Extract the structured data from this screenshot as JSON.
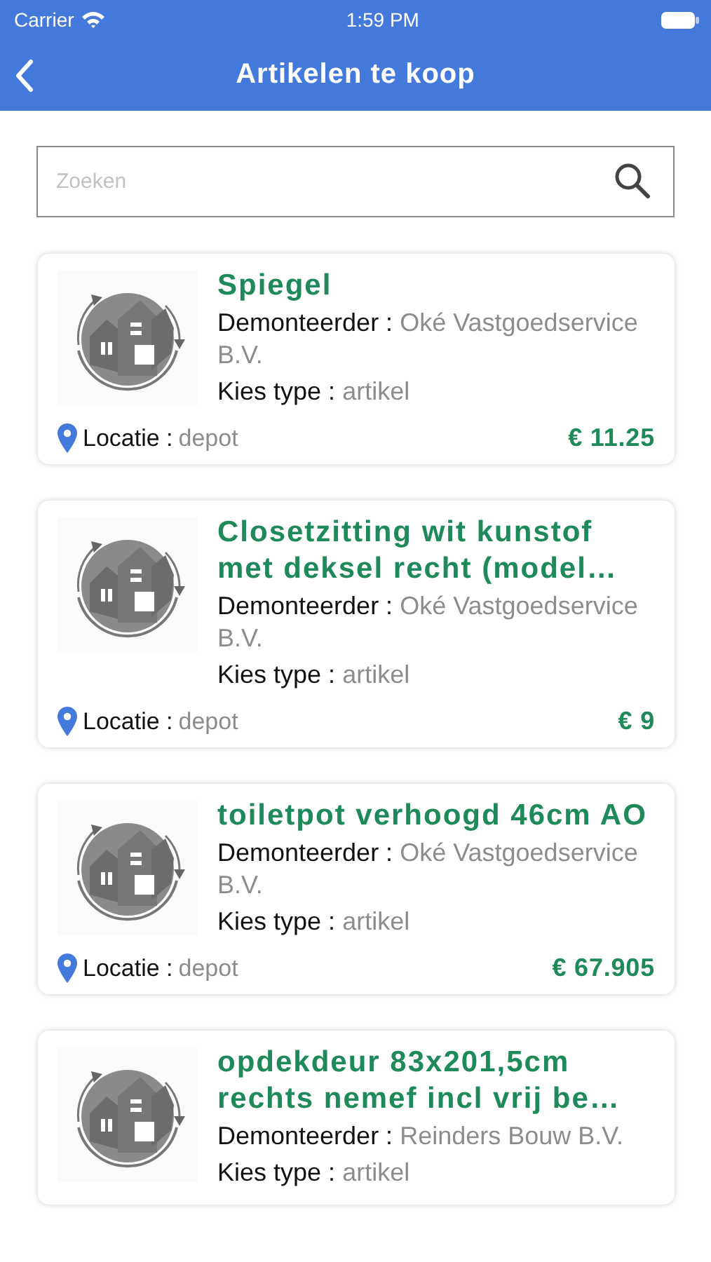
{
  "status_bar": {
    "carrier": "Carrier",
    "time": "1:59 PM"
  },
  "nav": {
    "title": "Artikelen te koop"
  },
  "search": {
    "placeholder": "Zoeken"
  },
  "items": [
    {
      "title": "Spiegel",
      "seller_label": "Demonteerder :",
      "seller": "Oké Vastgoedservice B.V.",
      "type_label": "Kies type :",
      "type": "artikel",
      "location_label": "Locatie :",
      "location": "depot",
      "price": "€ 11.25"
    },
    {
      "title": "Closetzitting wit kunstof met deksel recht (model…",
      "seller_label": "Demonteerder :",
      "seller": "Oké Vastgoedservice B.V.",
      "type_label": "Kies type :",
      "type": "artikel",
      "location_label": "Locatie :",
      "location": "depot",
      "price": "€ 9"
    },
    {
      "title": "toiletpot verhoogd 46cm AO",
      "seller_label": "Demonteerder :",
      "seller": "Oké Vastgoedservice B.V.",
      "type_label": "Kies type :",
      "type": "artikel",
      "location_label": "Locatie :",
      "location": "depot",
      "price": "€ 67.905"
    },
    {
      "title": "opdekdeur 83x201,5cm rechts nemef incl vrij be…",
      "seller_label": "Demonteerder :",
      "seller": "Reinders Bouw B.V.",
      "type_label": "Kies type :",
      "type": "artikel"
    }
  ]
}
